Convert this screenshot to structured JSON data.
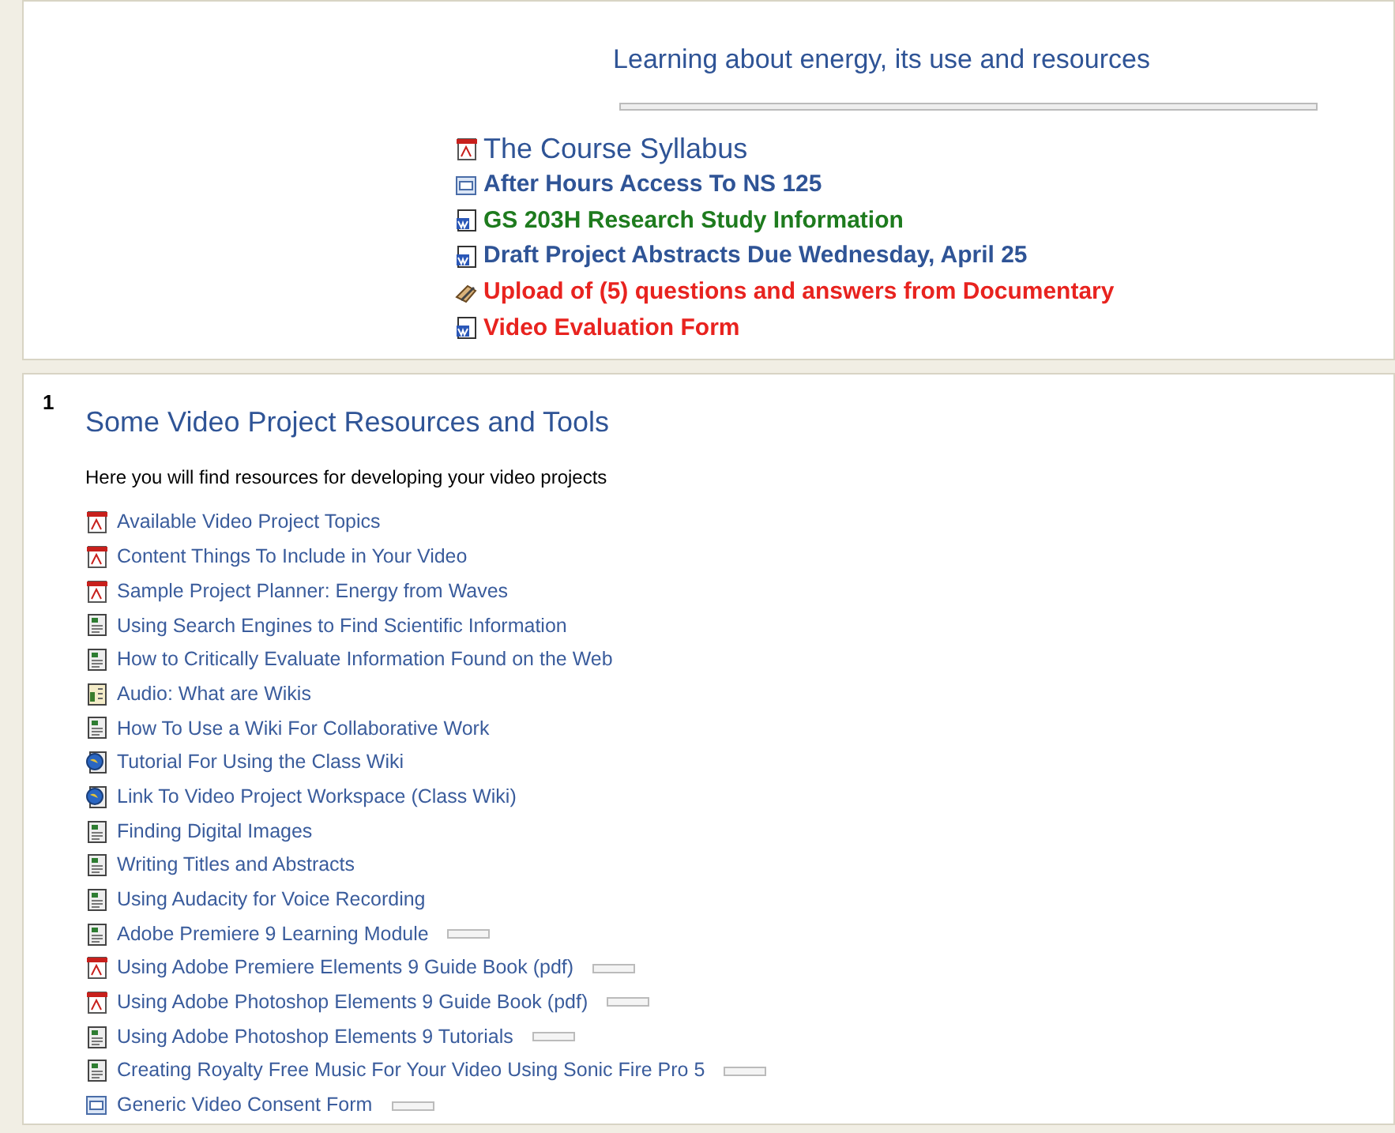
{
  "summary": {
    "title": "Learning about energy, its use and resources",
    "links": [
      {
        "label": "The Course Syllabus",
        "kind": "pdf",
        "color": "#2f5496",
        "bold": false
      },
      {
        "label": "After Hours Access To NS 125",
        "kind": "web",
        "color": "#2f5496",
        "bold": true
      },
      {
        "label": "GS 203H Research Study Information",
        "kind": "doc",
        "color": "#1e7b1e",
        "bold": true
      },
      {
        "label": "Draft Project Abstracts Due Wednesday, April 25",
        "kind": "doc",
        "color": "#2f5496",
        "bold": true
      },
      {
        "label": "Upload of (5) questions and answers from Documentary",
        "kind": "assignment",
        "color": "#e8231f",
        "bold": true
      },
      {
        "label": "Video Evaluation Form",
        "kind": "doc",
        "color": "#e8231f",
        "bold": true
      }
    ]
  },
  "section": {
    "number": "1",
    "title": "Some Video Project Resources and Tools",
    "description": "Here you will find resources for developing your video projects",
    "links": [
      {
        "label": "Available Video Project Topics",
        "kind": "pdf",
        "tag": false
      },
      {
        "label": "Content Things To Include in Your Video",
        "kind": "pdf",
        "tag": false
      },
      {
        "label": "Sample Project Planner: Energy from Waves",
        "kind": "pdf",
        "tag": false
      },
      {
        "label": "Using Search Engines to Find Scientific Information",
        "kind": "page",
        "tag": false
      },
      {
        "label": "How to Critically Evaluate Information Found on the Web",
        "kind": "page",
        "tag": false
      },
      {
        "label": "Audio: What are Wikis",
        "kind": "audio",
        "tag": false
      },
      {
        "label": "How To Use a Wiki For Collaborative Work",
        "kind": "page",
        "tag": false
      },
      {
        "label": "Tutorial For Using the Class Wiki",
        "kind": "globe",
        "tag": false
      },
      {
        "label": "Link To Video Project Workspace (Class Wiki)",
        "kind": "globe",
        "tag": false
      },
      {
        "label": "Finding Digital Images",
        "kind": "page",
        "tag": false
      },
      {
        "label": "Writing Titles and Abstracts",
        "kind": "page",
        "tag": false
      },
      {
        "label": "Using Audacity for Voice Recording",
        "kind": "page",
        "tag": false
      },
      {
        "label": "Adobe Premiere 9 Learning Module",
        "kind": "page",
        "tag": true
      },
      {
        "label": "Using Adobe Premiere Elements 9 Guide Book (pdf)",
        "kind": "pdf",
        "tag": true
      },
      {
        "label": "Using Adobe Photoshop Elements 9 Guide Book (pdf)",
        "kind": "pdf",
        "tag": true
      },
      {
        "label": "Using Adobe Photoshop Elements 9 Tutorials",
        "kind": "page",
        "tag": true
      },
      {
        "label": "Creating Royalty Free Music For Your Video Using Sonic Fire Pro 5",
        "kind": "page",
        "tag": true
      },
      {
        "label": "Generic Video Consent Form",
        "kind": "web",
        "tag": true
      }
    ]
  }
}
